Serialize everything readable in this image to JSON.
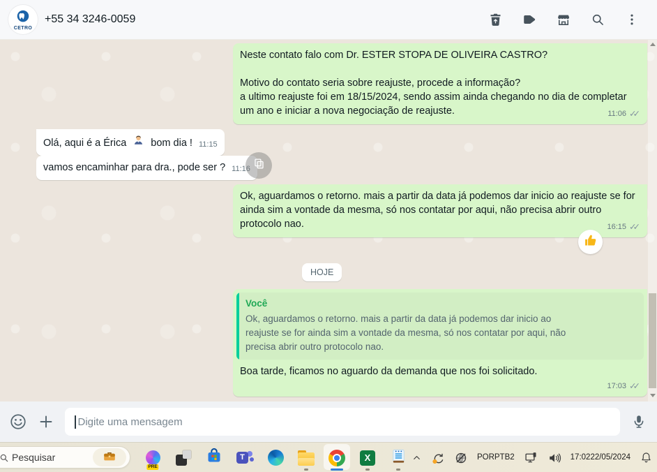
{
  "header": {
    "avatar": {
      "label": "CETRO",
      "icon": "tooth-logo"
    },
    "title": "+55 34 3246-0059",
    "actions": [
      {
        "label": "delete",
        "icon": "trash-icon"
      },
      {
        "label": "label",
        "icon": "tag-icon"
      },
      {
        "label": "catalog",
        "icon": "storefront-icon"
      },
      {
        "label": "search",
        "icon": "search-icon"
      },
      {
        "label": "menu",
        "icon": "kebab-menu-icon"
      }
    ]
  },
  "chat": {
    "date_divider": "HOJE",
    "messages": [
      {
        "direction": "out",
        "text": "Neste contato falo com Dr. ESTER STOPA DE OLIVEIRA CASTRO?\n\nMotivo do contato seria sobre reajuste, procede a informação?\na ultimo reajuste foi em 18/15/2024, sendo assim ainda chegando no dia de completar um ano e iniciar a nova negociação de reajuste.",
        "time": "11:06",
        "status": "delivered"
      },
      {
        "direction": "in",
        "text_before": "Olá, aqui é a Érica",
        "emoji": "👩‍💼",
        "text_after": "bom dia !",
        "time": "11:15"
      },
      {
        "direction": "in",
        "text": "vamos encaminhar para dra., pode ser ?",
        "time": "11:16"
      },
      {
        "direction": "out",
        "text": "Ok, aguardamos o retorno. mais a partir da data já podemos dar inicio ao reajuste se for ainda sim a vontade da mesma, só nos contatar por aqui, não precisa abrir outro protocolo nao.",
        "time": "16:15",
        "status": "delivered",
        "reaction": "👍"
      },
      {
        "direction": "out",
        "quote": {
          "author": "Você",
          "text": "Ok, aguardamos o retorno. mais a partir da data já podemos dar inicio ao reajuste se for ainda sim a vontade da mesma, só nos contatar por aqui, não precisa abrir outro protocolo nao."
        },
        "text": "Boa tarde, ficamos no aguardo da demanda que nos foi solicitado.",
        "time": "17:03",
        "status": "delivered"
      }
    ]
  },
  "composer": {
    "placeholder": "Digite uma mensagem",
    "icons": [
      "emoji-icon",
      "plus-icon",
      "mic-icon"
    ]
  },
  "taskbar": {
    "search": {
      "placeholder": "Pesquisar",
      "icon": "briefcase-icon"
    },
    "apps": [
      {
        "name": "copilot",
        "badge": "PRE"
      },
      {
        "name": "widgets"
      },
      {
        "name": "microsoft-store"
      },
      {
        "name": "teams",
        "letter": "T"
      },
      {
        "name": "edge"
      },
      {
        "name": "file-explorer",
        "running": true
      },
      {
        "name": "chrome",
        "running": true,
        "active": true
      },
      {
        "name": "excel",
        "letter": "X",
        "running": true
      },
      {
        "name": "notepad",
        "running": true
      }
    ],
    "tray": {
      "language_primary": "POR",
      "language_secondary": "PTB2",
      "time": "17:02",
      "date": "22/05/2024"
    }
  },
  "colors": {
    "outgoing_bubble": "#d8f6c9",
    "incoming_bubble": "#ffffff",
    "chat_background": "#ece5dd",
    "quote_bar": "#06cf9c",
    "quote_author": "#1fa855",
    "timestamp": "#667781",
    "header_bg": "#f7f8fa",
    "composer_bg": "#f0f2f5",
    "taskbar_bg": "#e9e5d8",
    "chrome_active_indicator": "#2f7fd6"
  }
}
